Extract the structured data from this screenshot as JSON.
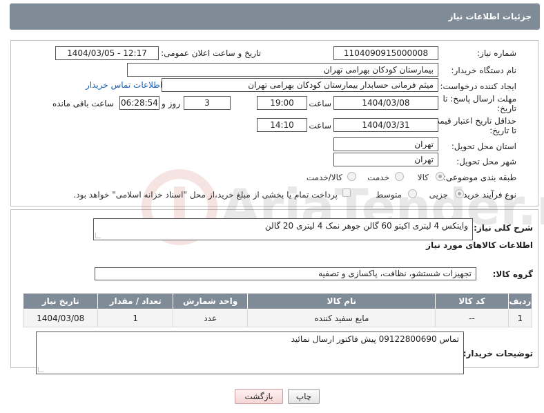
{
  "header": {
    "title": "جزئیات اطلاعات نیاز"
  },
  "fields": {
    "need_number": {
      "label": "شماره نیاز:",
      "value": "1104090915000008"
    },
    "announce_datetime": {
      "label": "تاریخ و ساعت اعلان عمومی:",
      "value": "1404/03/05 - 12:17"
    },
    "buyer_org": {
      "label": "نام دستگاه خریدار:",
      "value": "بیمارستان کودکان بهرامی تهران"
    },
    "requester": {
      "label": "ایجاد کننده درخواست:",
      "value": "میثم  فرمانی حسابدار بیمارستان کودکان بهرامی تهران",
      "contact_link": "اطلاعات تماس خریدار"
    },
    "reply_deadline": {
      "label_line1": "مهلت ارسال پاسخ: تا",
      "label_line2": "تاریخ:",
      "date": "1404/03/08",
      "time_label": "ساعت",
      "time": "19:00",
      "days": "3",
      "days_label": "روز و",
      "remaining": "06:28:54",
      "remaining_label": "ساعت باقی مانده"
    },
    "price_validity": {
      "label_line1": "حداقل تاریخ اعتبار قیمت:",
      "label_line2": "تا تاریخ:",
      "date": "1404/03/31",
      "time_label": "ساعت",
      "time": "14:10"
    },
    "delivery_province": {
      "label": "استان محل تحویل:",
      "value": "تهران"
    },
    "delivery_city": {
      "label": "شهر محل تحویل:",
      "value": "تهران"
    },
    "category": {
      "label": "طبقه بندی موضوعی:",
      "options": [
        "کالا",
        "خدمت",
        "کالا/خدمت"
      ],
      "selected": "کالا"
    },
    "purchase_process": {
      "label": "نوع فرآیند خرید :",
      "options": [
        "جزیی",
        "متوسط"
      ],
      "selected": "جزیی",
      "payment_note": "پرداخت تمام یا بخشی از مبلغ خرید،از محل \"اسناد خزانه اسلامی\" خواهد بود."
    }
  },
  "description": {
    "label": "شرح کلی نیاز:",
    "value": "وایتکس 4 لیتری اکیتو 60 گالن  جوهر نمک 4 لیتری 20 گالن"
  },
  "goods_section": {
    "title": "اطلاعات کالاهای مورد نیاز"
  },
  "goods_group": {
    "label": "گروه کالا:",
    "value": "تجهیزات شستشو، نظافت، پاکسازی و تصفیه"
  },
  "table": {
    "headers": [
      "ردیف",
      "کد کالا",
      "نام کالا",
      "واحد شمارش",
      "تعداد / مقدار",
      "تاریخ نیاز"
    ],
    "rows": [
      [
        "1",
        "--",
        "مایع سفید کننده",
        "عدد",
        "1",
        "1404/03/08"
      ]
    ]
  },
  "buyer_notes": {
    "label": "توضیحات خریدار:",
    "value": "تماس 09122800690 پیش فاکتور ارسال نمائید"
  },
  "buttons": {
    "print": "چاپ",
    "back": "بازگشت"
  },
  "watermark": {
    "text": "AriaTender.neT"
  },
  "colors": {
    "header_bg": "#7f8c98",
    "link": "#1a5fb4",
    "back_button": "#f6d6d6"
  }
}
